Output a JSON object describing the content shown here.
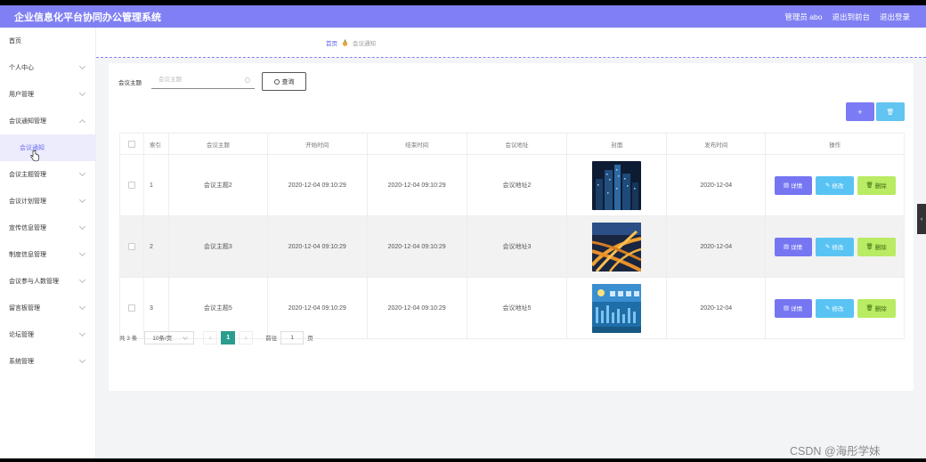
{
  "header": {
    "title": "企业信息化平台协同办公管理系统",
    "user_label": "管理员 abo",
    "to_front_label": "退出到前台",
    "logout_label": "退出登录"
  },
  "sidebar": {
    "items": [
      {
        "label": "首页"
      },
      {
        "label": "个人中心"
      },
      {
        "label": "用户管理"
      },
      {
        "label": "会议通知管理"
      },
      {
        "label": "会议通知"
      },
      {
        "label": "会议主题管理"
      },
      {
        "label": "会议计划管理"
      },
      {
        "label": "宣传信息管理"
      },
      {
        "label": "制度信息管理"
      },
      {
        "label": "会议参与人数管理"
      },
      {
        "label": "留言板管理"
      },
      {
        "label": "论坛管理"
      },
      {
        "label": "系统管理"
      }
    ]
  },
  "breadcrumb": {
    "home": "首页",
    "current": "会议通知"
  },
  "search": {
    "label": "会议主题",
    "placeholder": "会议主题",
    "query_label": "查询"
  },
  "toolbar": {
    "add_label": "+",
    "delete_label": "🗑"
  },
  "table": {
    "headers": {
      "index": "索引",
      "topic": "会议主题",
      "start": "开始时间",
      "end": "结束时间",
      "address": "会议地址",
      "cover": "封面",
      "publish_date": "发布时间",
      "ops": "操作"
    },
    "rows": [
      {
        "index": "1",
        "topic": "会议主题2",
        "start": "2020-12-04 09:10:29",
        "end": "2020-12-04 09:10:29",
        "address": "会议地址2",
        "publish_date": "2020-12-04",
        "cover_icon": "night-city-image"
      },
      {
        "index": "2",
        "topic": "会议主题3",
        "start": "2020-12-04 09:10:29",
        "end": "2020-12-04 09:10:29",
        "address": "会议地址3",
        "publish_date": "2020-12-04",
        "cover_icon": "highway-interchange-image"
      },
      {
        "index": "3",
        "topic": "会议主题5",
        "start": "2020-12-04 09:10:29",
        "end": "2020-12-04 09:10:29",
        "address": "会议地址5",
        "publish_date": "2020-12-04",
        "cover_icon": "weather-dashboard-image"
      }
    ],
    "ops": {
      "detail": "详情",
      "edit": "修改",
      "delete": "删除"
    }
  },
  "pager": {
    "total": "共 3 条",
    "page_size": "10条/页",
    "current_page": "1",
    "goto_label": "前往",
    "goto_value": "1",
    "goto_suffix": "页"
  },
  "watermark": "CSDN @海彤学妹",
  "colors": {
    "primary": "#8080f4",
    "detail": "#7676f3",
    "edit": "#59c4f3",
    "delete": "#b9eb63",
    "page_active": "#2a9d8f"
  }
}
